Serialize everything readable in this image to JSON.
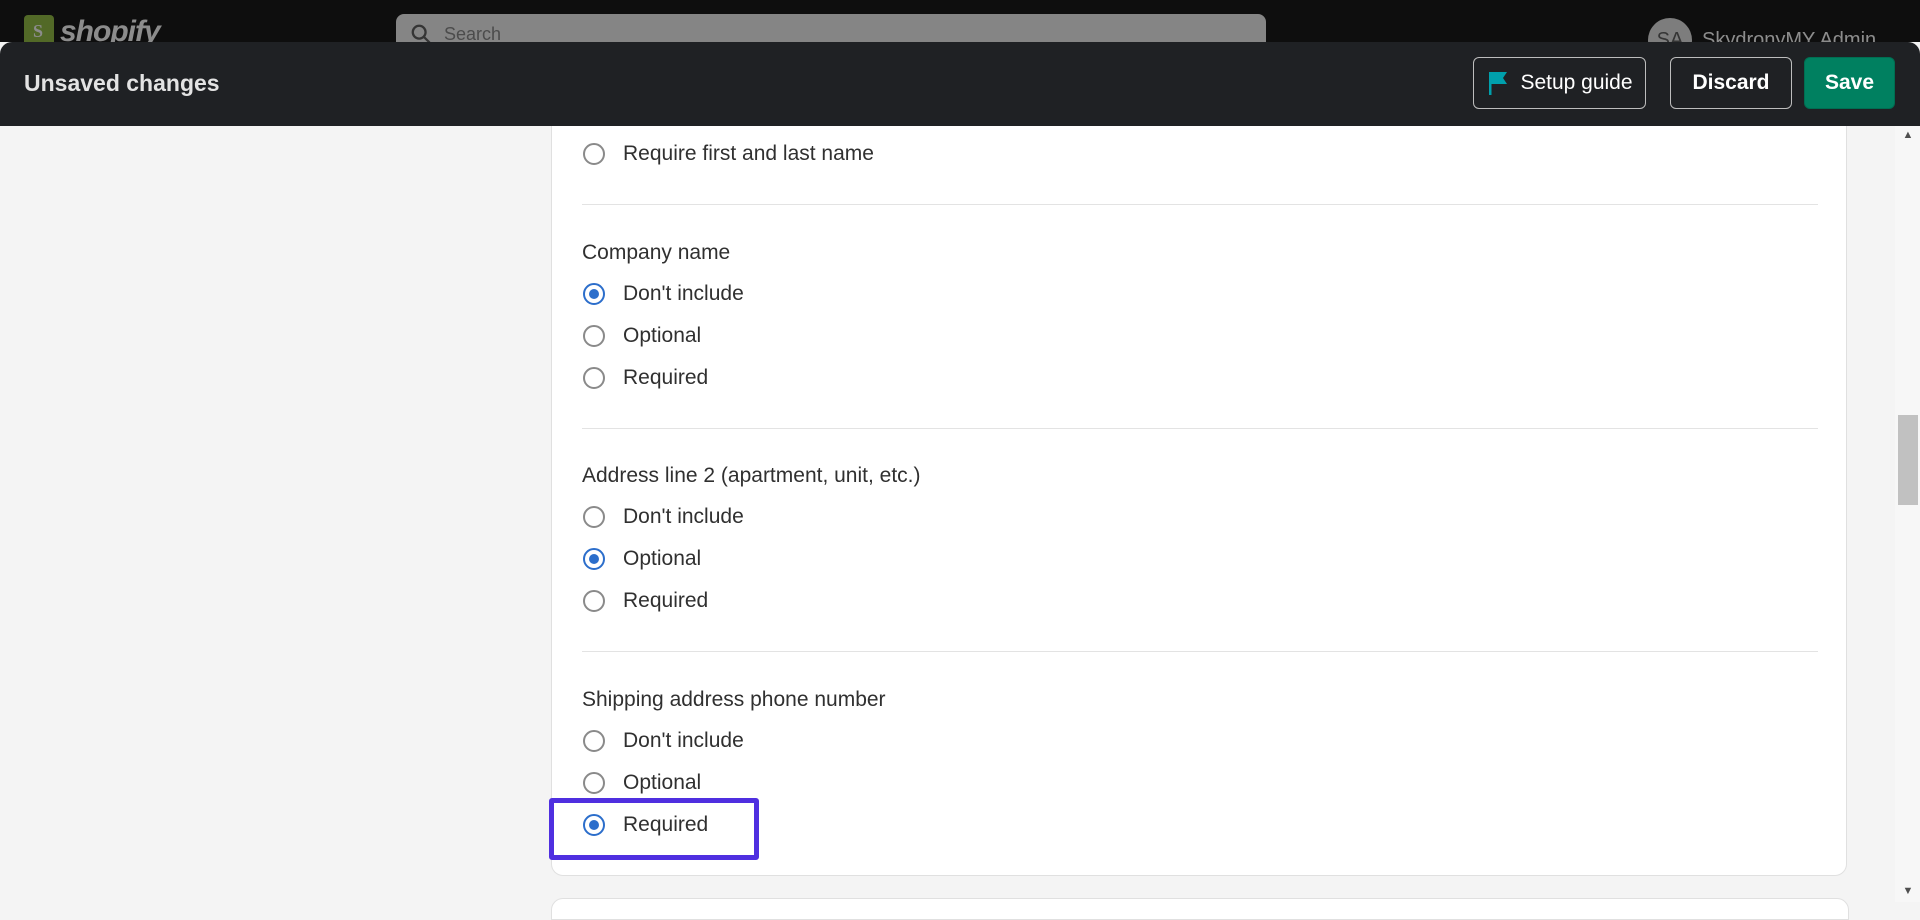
{
  "admin_header": {
    "logo_text": "shopify",
    "search_placeholder": "Search",
    "avatar_initials": "SA",
    "store_name": "SkydronyMY Admin"
  },
  "save_bar": {
    "title": "Unsaved changes",
    "setup_guide_label": "Setup guide",
    "discard_label": "Discard",
    "save_label": "Save"
  },
  "form": {
    "name_option": "Require first and last name",
    "company": {
      "title": "Company name",
      "options": [
        "Don't include",
        "Optional",
        "Required"
      ],
      "selected": "Don't include"
    },
    "address2": {
      "title": "Address line 2 (apartment, unit, etc.)",
      "options": [
        "Don't include",
        "Optional",
        "Required"
      ],
      "selected": "Optional"
    },
    "phone": {
      "title": "Shipping address phone number",
      "options": [
        "Don't include",
        "Optional",
        "Required"
      ],
      "selected": "Required"
    }
  },
  "colors": {
    "save_bar_bg": "#1f2124",
    "save_button": "#008060",
    "radio_checked": "#2c6ecb",
    "highlight_box": "#4f2fe0",
    "setup_flag": "#00a0ac"
  }
}
